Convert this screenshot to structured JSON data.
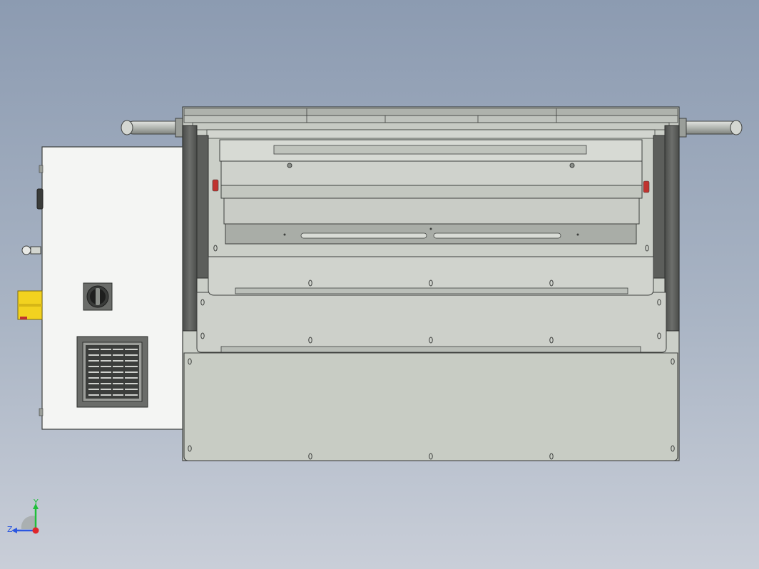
{
  "viewport": {
    "background_top": "#8c9bb1",
    "background_bottom": "#c9ced8"
  },
  "model": {
    "body_color": "#c8ccc4",
    "frame_color": "#5a5c5a",
    "accent_color": "#f2d21f",
    "handle_color": "#b9bdb8"
  },
  "triad": {
    "y_label": "Y",
    "z_label": "Z",
    "y_color": "#1fbf3a",
    "z_color": "#2b57e0",
    "x_color": "#e0262b"
  }
}
